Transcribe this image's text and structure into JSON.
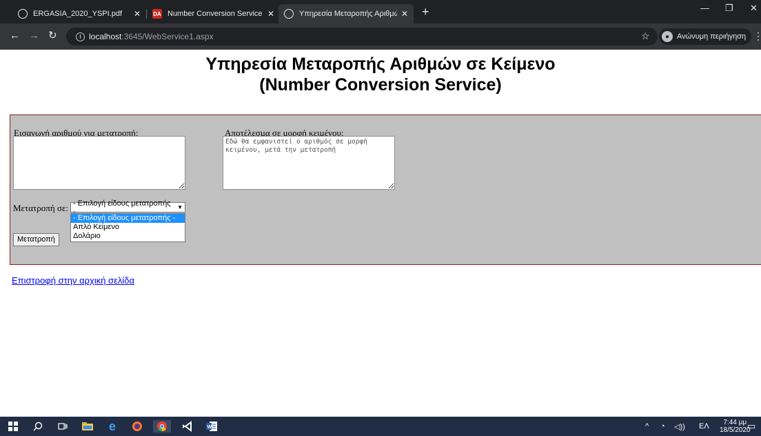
{
  "browser": {
    "tabs": [
      {
        "title": "ERGASIA_2020_YSPI.pdf",
        "icon": "globe-icon",
        "active": false
      },
      {
        "title": "Number Conversion Service",
        "icon": "da-favicon",
        "active": false
      },
      {
        "title": "Υπηρεσία Μεταροπής Αριθμών",
        "icon": "globe-icon",
        "active": true
      }
    ],
    "url_host": "localhost",
    "url_rest": ":3645/WebService1.aspx",
    "profile_label": "Ανώνυμη περιήγηση"
  },
  "page": {
    "title_line1": "Υπηρεσία Μεταροπής Αριθμών σε Κείμενο",
    "title_line2": "(Number Conversion Service)",
    "input_label": "Εισαγωγή αριθμού για μετατροπή:",
    "input_value": "",
    "output_label": "Αποτέλεσμα σε μορφή κειμένου:",
    "output_placeholder": "Εδώ θα εμφανιστεί ο αριθμός σε μορφή κειμένου, μετά την μετατροπή",
    "convert_to_label": "Μετατροπή σε:",
    "select_value": "- Επιλογή είδους μετατροπής -",
    "select_options": [
      "- Επιλογή είδους μετατροπής -",
      "Απλό Κείμενο",
      "Δολάριο"
    ],
    "convert_button": "Μετατροπή",
    "back_link": "Επιστροφή στην αρχική σελίδα"
  },
  "taskbar": {
    "language": "ΕΛ",
    "time": "7:44 μμ",
    "date": "18/5/2020"
  }
}
